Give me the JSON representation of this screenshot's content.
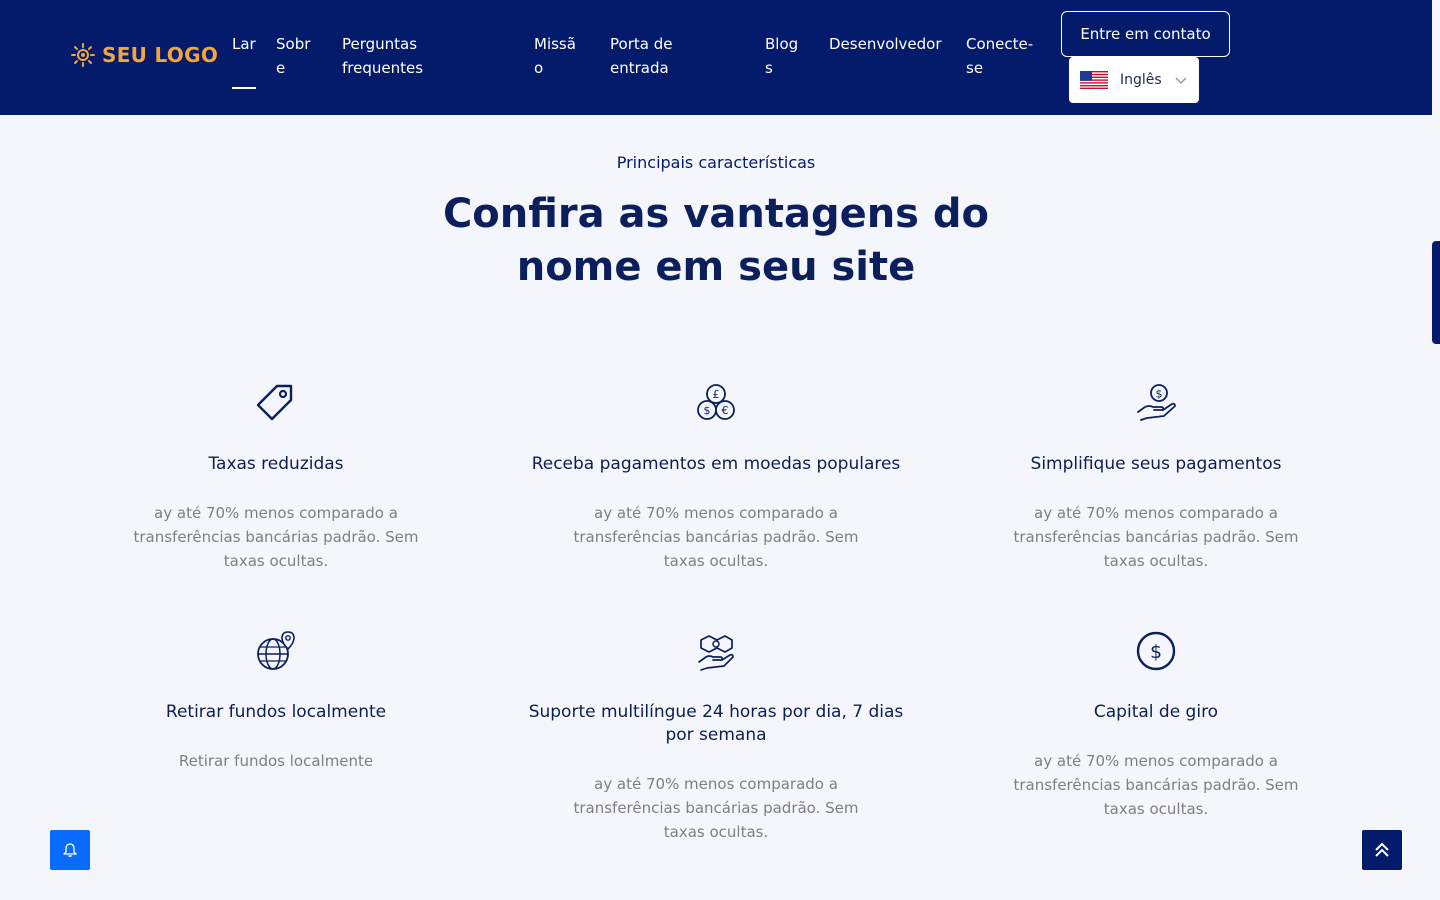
{
  "header": {
    "logo_text": "SEU LOGO",
    "nav": [
      {
        "label": "Lar"
      },
      {
        "label": "Sobre"
      },
      {
        "label": "Perguntas frequentes"
      },
      {
        "label": "Missão"
      },
      {
        "label": "Porta de entrada"
      },
      {
        "label": "Blogs"
      },
      {
        "label": "Desenvolvedor"
      },
      {
        "label": "Conecte-se"
      }
    ],
    "contact_button": "Entre em contato",
    "language": "Inglês"
  },
  "section": {
    "subtitle": "Principais características",
    "title": "Confira as vantagens do nome em seu site"
  },
  "features": [
    {
      "icon": "price-tag-icon",
      "title": "Taxas reduzidas",
      "description": "ay até 70% menos comparado a transferências bancárias padrão. Sem taxas ocultas."
    },
    {
      "icon": "currency-coins-icon",
      "title": "Receba pagamentos em moedas populares",
      "description": "ay até 70% menos comparado a transferências bancárias padrão. Sem taxas ocultas."
    },
    {
      "icon": "hand-dollar-icon",
      "title": "Simplifique seus pagamentos",
      "description": "ay até 70% menos comparado a transferências bancárias padrão. Sem taxas ocultas."
    },
    {
      "icon": "globe-location-icon",
      "title": "Retirar fundos localmente",
      "description": "Retirar fundos localmente"
    },
    {
      "icon": "handshake-support-icon",
      "title": "Suporte multilíngue 24 horas por dia, 7 dias por semana",
      "description": "ay até 70% menos comparado a transferências bancárias padrão. Sem taxas ocultas."
    },
    {
      "icon": "dollar-circle-icon",
      "title": "Capital de giro",
      "description": "ay até 70% menos comparado a transferências bancárias padrão. Sem taxas ocultas."
    }
  ],
  "colors": {
    "header_bg": "#041b6b",
    "accent_logo": "#f2a53a",
    "bell_button": "#0a6cff",
    "text_dark": "#0b1f5c",
    "text_muted": "#7a7f89"
  }
}
